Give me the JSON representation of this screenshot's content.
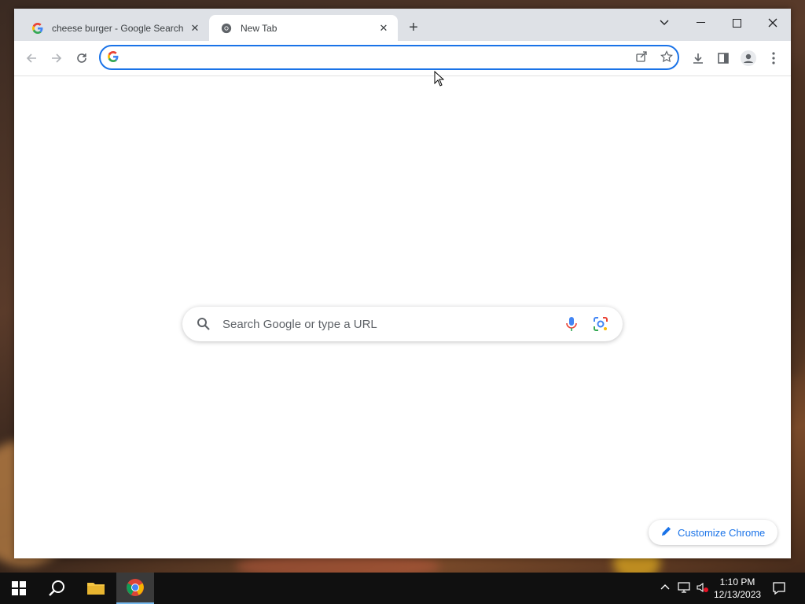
{
  "tabs": [
    {
      "title": "cheese burger - Google Search",
      "favicon": "google-g-icon",
      "active": false
    },
    {
      "title": "New Tab",
      "favicon": "chrome-icon",
      "active": true
    }
  ],
  "omnibox": {
    "value": "",
    "placeholder": ""
  },
  "ntp": {
    "search_placeholder": "Search Google or type a URL",
    "customize_label": "Customize Chrome"
  },
  "taskbar": {
    "time": "1:10 PM",
    "date": "12/13/2023"
  },
  "colors": {
    "accent": "#1a73e8",
    "tabstrip": "#dee1e6",
    "taskbar": "#101010"
  }
}
